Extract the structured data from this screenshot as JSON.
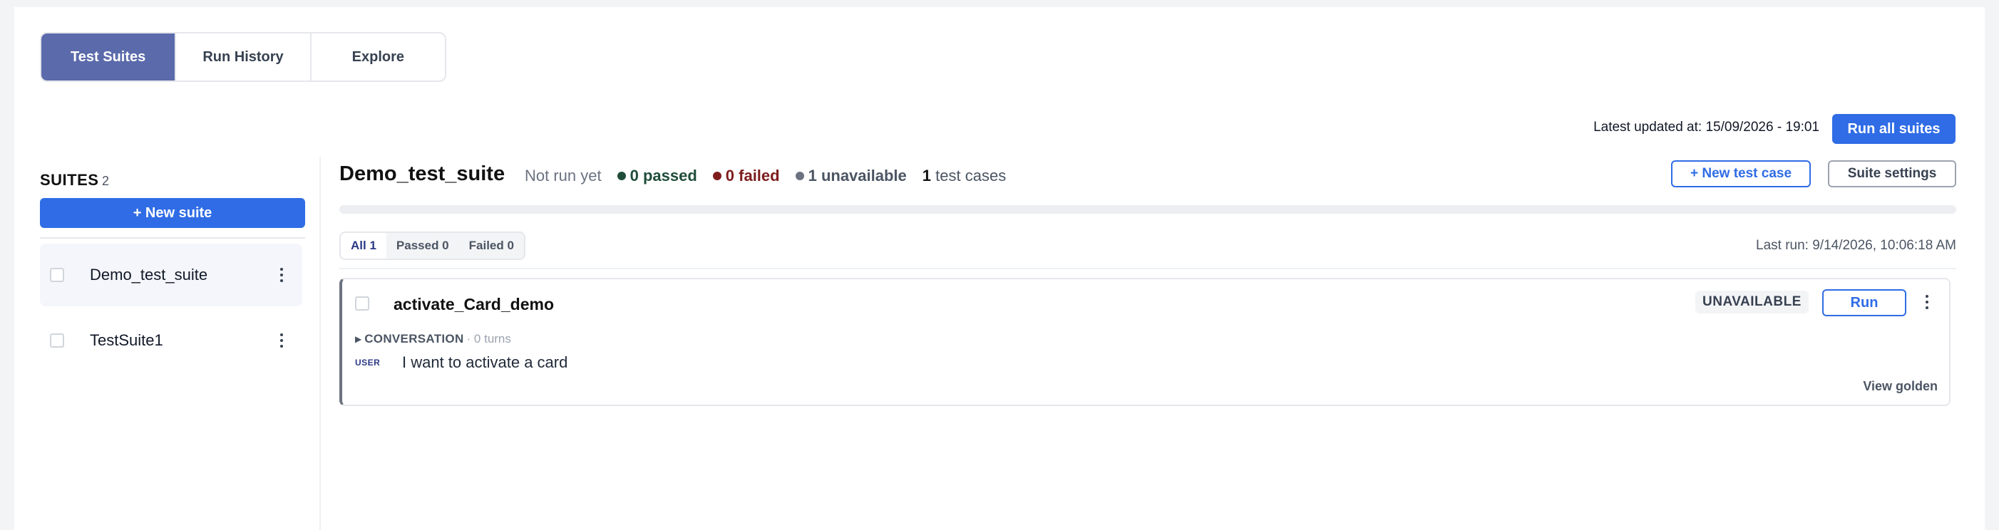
{
  "tabs": [
    {
      "label": "Test Suites",
      "active": true
    },
    {
      "label": "Run History",
      "active": false
    },
    {
      "label": "Explore",
      "active": false
    }
  ],
  "header": {
    "latest_updated": "Latest updated at: 15/09/2026 - 19:01",
    "run_all_label": "Run all suites"
  },
  "sidebar": {
    "title": "SUITES",
    "count": "2",
    "new_suite_label": "+ New suite",
    "items": [
      {
        "name": "Demo_test_suite",
        "selected": true
      },
      {
        "name": "TestSuite1",
        "selected": false
      }
    ]
  },
  "suite": {
    "title": "Demo_test_suite",
    "status": "Not run yet",
    "passed": "0 passed",
    "failed": "0 failed",
    "unavailable": "1 unavailable",
    "cases_count": "1",
    "cases_label": "test cases",
    "new_case_label": "+ New test case",
    "settings_label": "Suite settings",
    "last_run": "Last run: 9/14/2026, 10:06:18 AM"
  },
  "filters": [
    {
      "label": "All 1",
      "active": true
    },
    {
      "label": "Passed 0",
      "active": false
    },
    {
      "label": "Failed 0",
      "active": false
    }
  ],
  "test_case": {
    "name": "activate_Card_demo",
    "badge": "UNAVAILABLE",
    "run_label": "Run",
    "conversation_label": "CONVERSATION",
    "turns": "· 0 turns",
    "role": "USER",
    "message": "I want to activate a card",
    "view_golden": "View golden"
  },
  "colors": {
    "accent": "#2f6ce5",
    "tab_active": "#5b6aab",
    "passed_dot": "#1f4d3a",
    "failed_dot": "#7f1d1d",
    "unavailable_dot": "#6b7280"
  }
}
